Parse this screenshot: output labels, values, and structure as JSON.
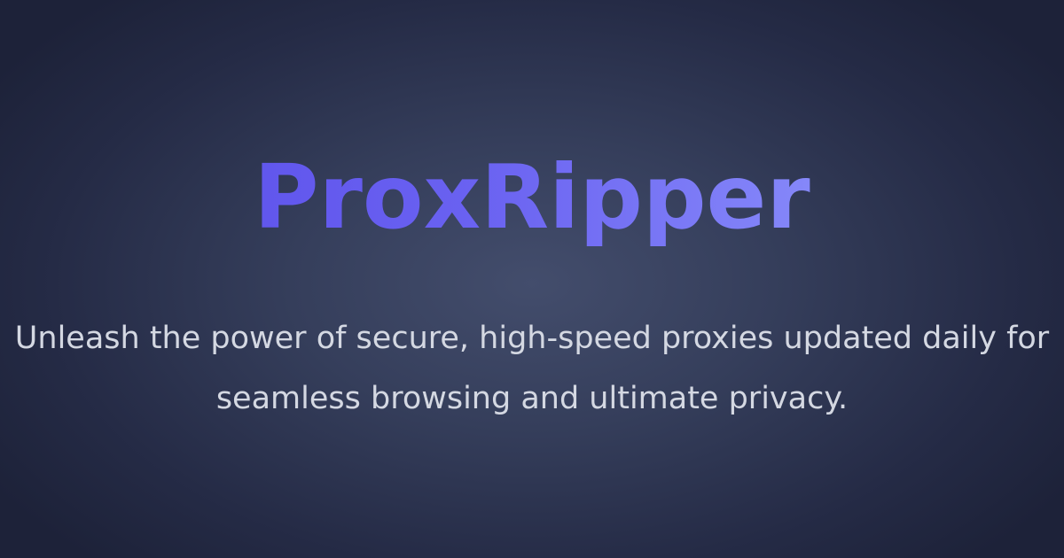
{
  "hero": {
    "title": "ProxRipper",
    "tagline": "Unleash the power of secure, high-speed proxies updated daily for seamless browsing and ultimate privacy."
  },
  "colors": {
    "background_center": "#434d6c",
    "background_edge": "#1d2239",
    "title_gradient_start": "#5649e8",
    "title_gradient_end": "#9aa4ff",
    "tagline_text": "#d4d8e2"
  }
}
